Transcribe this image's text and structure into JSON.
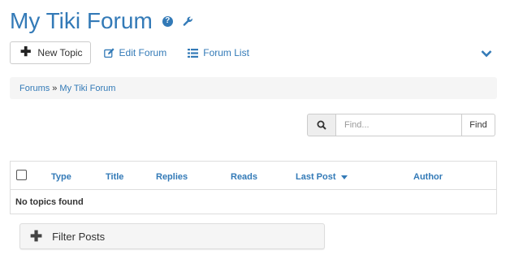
{
  "page": {
    "title": "My Tiki Forum",
    "help_icon_glyph": "?"
  },
  "toolbar": {
    "new_topic_label": "New Topic",
    "edit_forum_label": "Edit Forum",
    "forum_list_label": "Forum List"
  },
  "breadcrumb": {
    "items": [
      "Forums",
      "My Tiki Forum"
    ],
    "separator": "»"
  },
  "search": {
    "placeholder": "Find...",
    "button_label": "Find"
  },
  "table": {
    "columns": [
      "Type",
      "Title",
      "Replies",
      "Reads",
      "Last Post",
      "Author"
    ],
    "empty_message": "No topics found"
  },
  "filter": {
    "label": "Filter Posts"
  },
  "icons": {
    "help": "question-circle-icon",
    "settings": "wrench-icon",
    "add": "plus-icon",
    "edit": "edit-icon",
    "list": "list-icon",
    "collapse": "chevron-down-icon",
    "search": "search-icon"
  },
  "colors": {
    "link": "#337ab7",
    "breadcrumb_bg": "#f5f5f5"
  }
}
